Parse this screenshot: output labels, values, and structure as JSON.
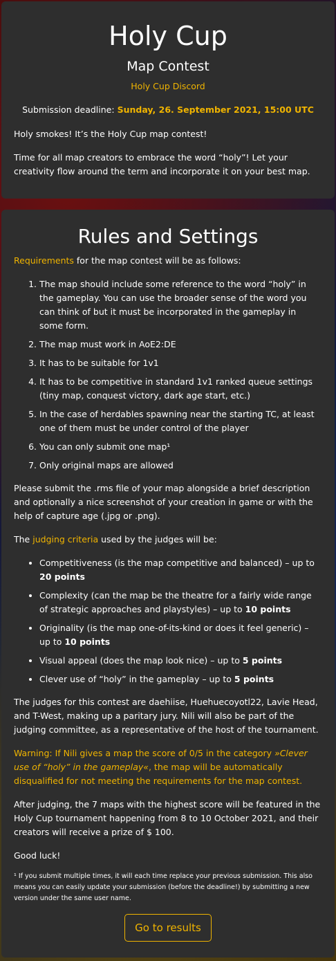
{
  "header": {
    "title": "Holy Cup",
    "subtitle": "Map Contest",
    "discord_link": "Holy Cup Discord",
    "deadline_label": "Submission deadline:",
    "deadline_value": "Sunday, 26. September 2021, 15:00 UTC",
    "intro_1": "Holy smokes! It’s the Holy Cup map contest!",
    "intro_2": "Time for all map creators to embrace the word “holy”! Let your creativity flow around the term and incorporate it on your best map."
  },
  "rules": {
    "title": "Rules and Settings",
    "req_link": "Requirements",
    "req_text": " for the map contest will be as follows:",
    "items": [
      "The map should include some reference to the word “holy” in the gameplay. You can use the broader sense of the word you can think of but it must be incorporated in the gameplay in some form.",
      "The map must work in AoE2:DE",
      "It has to be suitable for 1v1",
      "It has to be competitive in standard 1v1 ranked queue settings (tiny map, conquest victory, dark age start, etc.)",
      "In the case of herdables spawning near the starting TC, at least one of them must be under control of the player",
      "You can only submit one map¹",
      "Only original maps are allowed"
    ],
    "submit_text": "Please submit the .rms file of your map alongside a brief description and optionally a nice screenshot of your creation in game or with the help of capture age (.jpg or .png).",
    "judging_pre": "The ",
    "judging_link": "judging criteria",
    "judging_post": " used by the judges will be:",
    "criteria": [
      {
        "text": "Competitiveness (is the map competitive and balanced) – up to ",
        "points": "20 points"
      },
      {
        "text": "Complexity (can the map be the theatre for a fairly wide range of strategic approaches and playstyles) – up to ",
        "points": "10 points"
      },
      {
        "text": "Originality (is the map one-of-its-kind or does it feel generic) – up to ",
        "points": "10 points"
      },
      {
        "text": "Visual appeal (does the map look nice) – up to ",
        "points": "5 points"
      },
      {
        "text": "Clever use of “holy” in the gameplay – up to ",
        "points": "5 points"
      }
    ],
    "judges_text": "The judges for this contest are daehiise, Huehuecoyotl22, Lavie Head, and T-West, making up a paritary jury. Nili will also be part of the judging committee, as a representative of the host of the tournament.",
    "warning_pre": "Warning: If Nili gives a map the score of 0/5 in the category ",
    "warning_em": "»Clever use of “holy” in the gameplay«",
    "warning_post": ", the map will be automatically disqualified for not meeting the requirements for the map contest.",
    "after_text": "After judging, the 7 maps with the highest score will be featured in the Holy Cup tournament happening from 8 to 10 October 2021, and their creators will receive a prize of $ 100.",
    "good_luck": "Good luck!",
    "footnote": "¹ If you submit multiple times, it will each time replace your previous submission. This also means you can easily update your submission (before the deadline!) by submitting a new version under the same user name.",
    "button_label": "Go to results"
  },
  "colors": {
    "accent": "#f0b400",
    "card_background": "#2e2e2e"
  }
}
